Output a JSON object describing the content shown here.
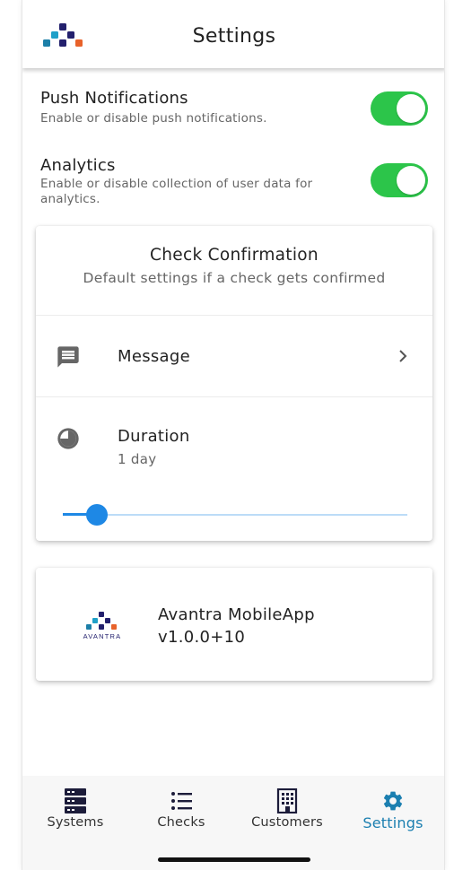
{
  "header": {
    "title": "Settings",
    "logo_icon": "avantra-logo-icon"
  },
  "settings": [
    {
      "title": "Push Notifications",
      "subtitle": "Enable or disable push notifications.",
      "enabled": true
    },
    {
      "title": "Analytics",
      "subtitle": "Enable or disable collection of user data for analytics.",
      "enabled": true
    }
  ],
  "check_confirmation": {
    "title": "Check Confirmation",
    "subtitle": "Default settings if a check gets confirmed",
    "message": {
      "label": "Message",
      "icon": "message-icon"
    },
    "duration": {
      "label": "Duration",
      "value": "1 day",
      "icon": "clock-icon",
      "slider_level": 0.1
    }
  },
  "about": {
    "logo_text": "AVANTRA",
    "name": "Avantra MobileApp",
    "version": "v1.0.0+10"
  },
  "bottom_nav": {
    "active": "Settings",
    "tabs": [
      {
        "label": "Systems",
        "icon": "server-icon"
      },
      {
        "label": "Checks",
        "icon": "list-icon"
      },
      {
        "label": "Customers",
        "icon": "building-icon"
      },
      {
        "label": "Settings",
        "icon": "gear-icon"
      }
    ]
  },
  "colors": {
    "toggle_on": "#2cc54a",
    "accent": "#1e88e5",
    "active_tab": "#1b7fb0"
  }
}
